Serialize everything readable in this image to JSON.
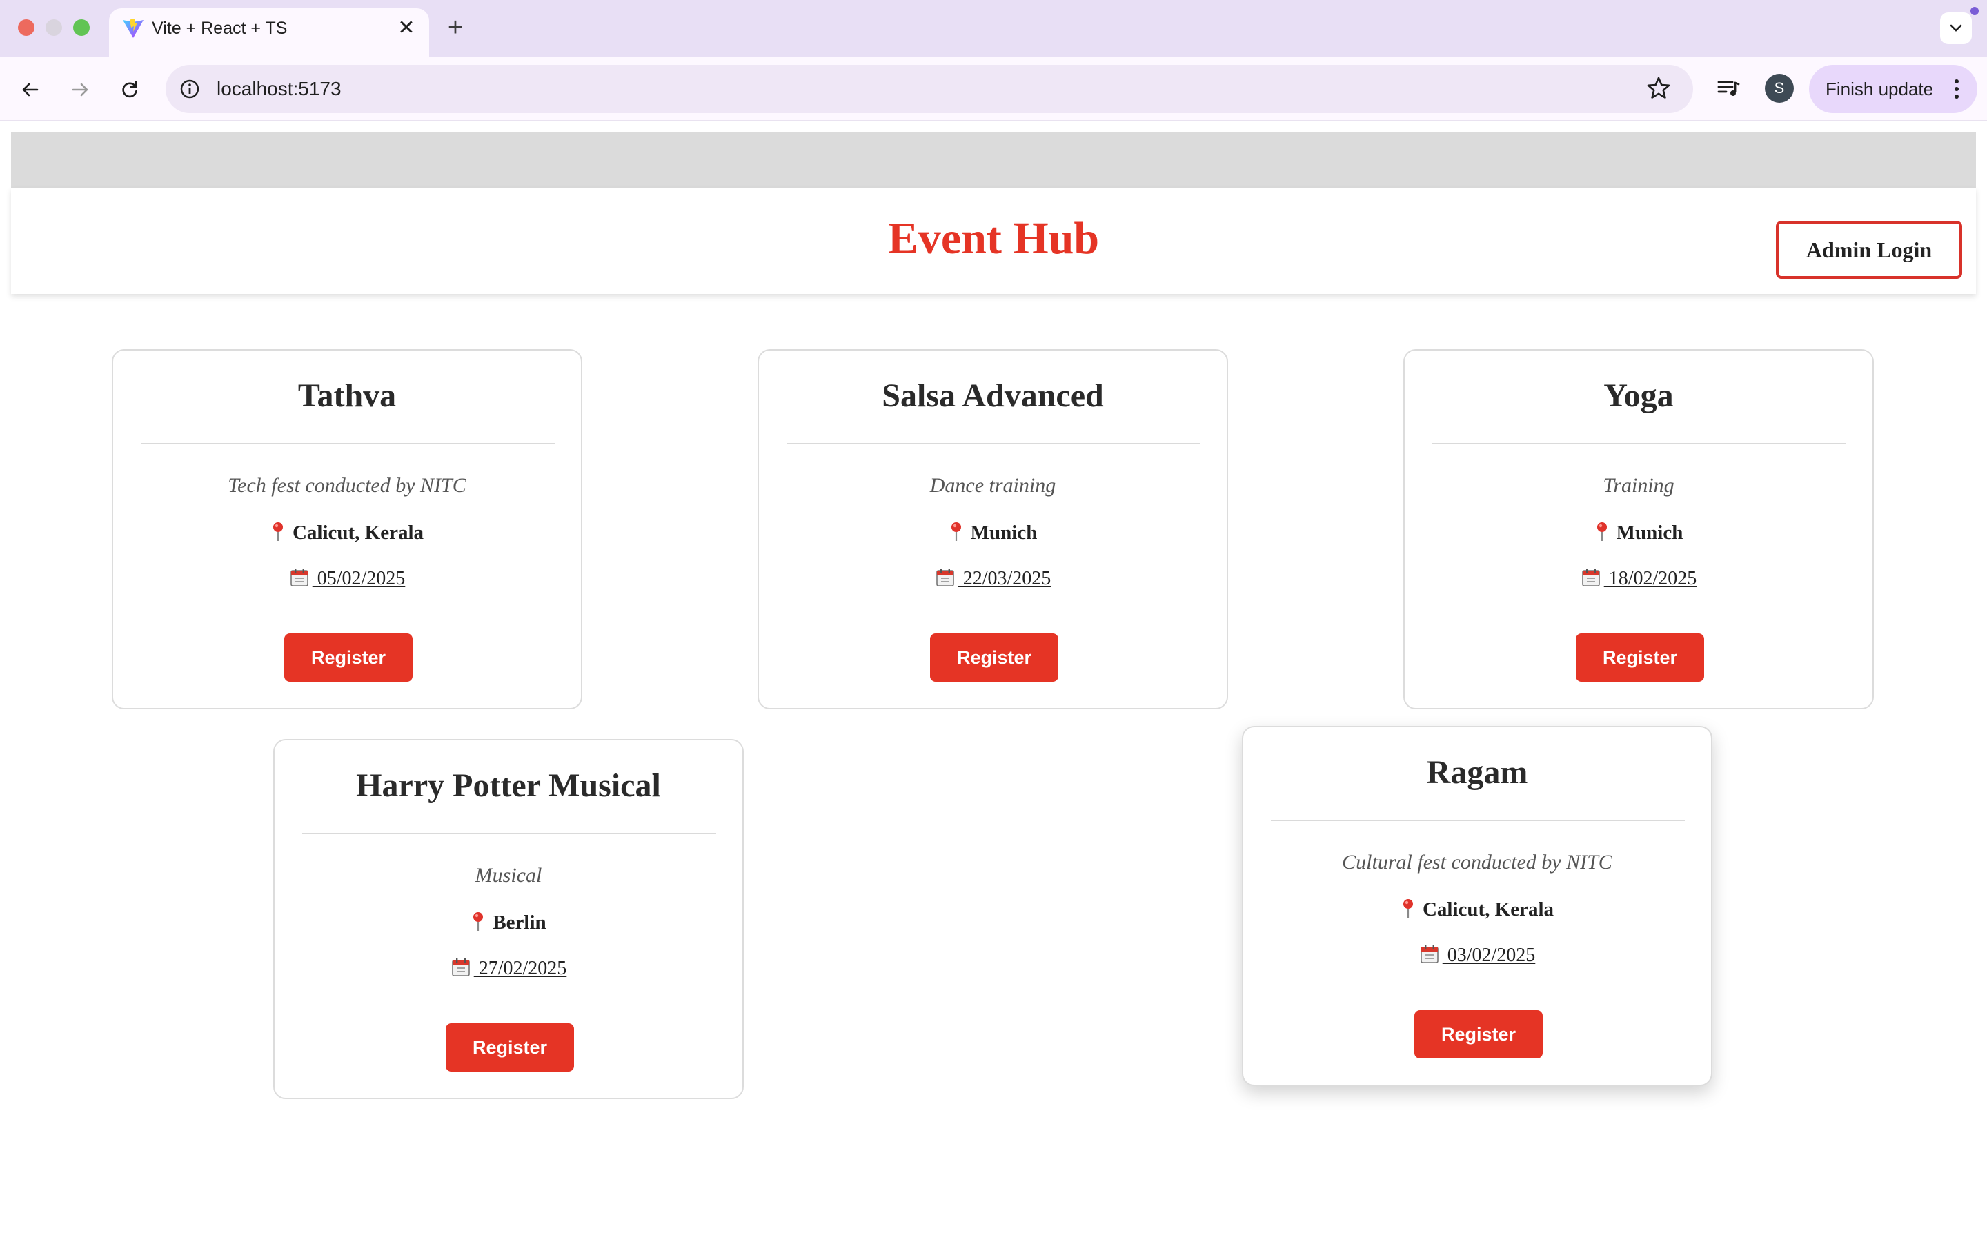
{
  "browser": {
    "tab": {
      "title": "Vite + React + TS",
      "close_glyph": "✕"
    },
    "new_tab_glyph": "+",
    "address": "localhost:5173",
    "profile_initial": "S",
    "finish_update_label": "Finish update",
    "accent_color": "#e8d8fb"
  },
  "page": {
    "title": "Event Hub",
    "admin_login_label": "Admin Login",
    "brand_color": "#e53425"
  },
  "events": [
    {
      "name": "Tathva",
      "description": "Tech fest conducted by NITC",
      "location": "Calicut, Kerala",
      "date": " 05/02/2025",
      "register_label": "Register"
    },
    {
      "name": "Salsa Advanced",
      "description": "Dance training",
      "location": "Munich",
      "date": " 22/03/2025",
      "register_label": "Register"
    },
    {
      "name": "Yoga",
      "description": "Training",
      "location": "Munich",
      "date": " 18/02/2025",
      "register_label": "Register"
    },
    {
      "name": "Harry Potter Musical",
      "description": "Musical",
      "location": "Berlin",
      "date": " 27/02/2025",
      "register_label": "Register"
    },
    {
      "name": "Ragam",
      "description": "Cultural fest conducted by NITC",
      "location": "Calicut, Kerala",
      "date": " 03/02/2025",
      "register_label": "Register"
    }
  ]
}
